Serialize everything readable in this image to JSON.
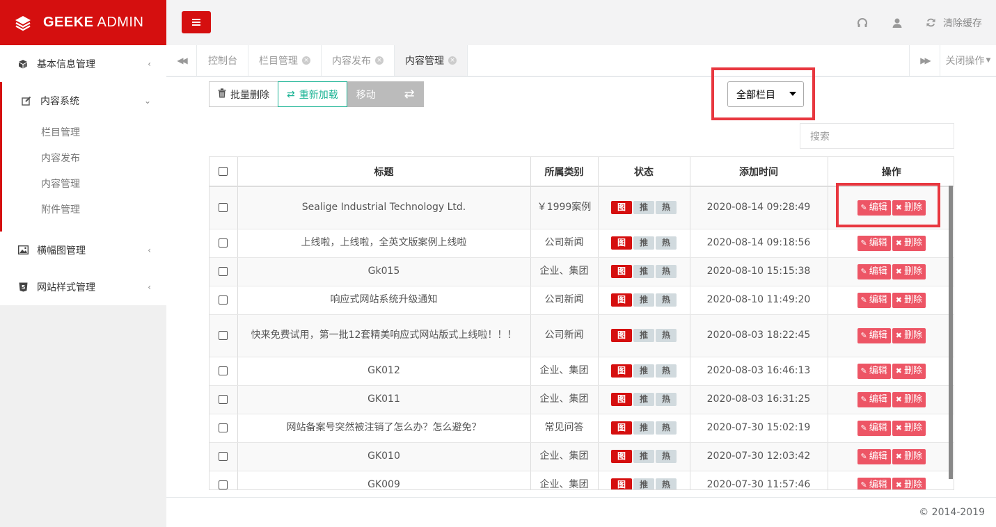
{
  "brand": {
    "name_bold": "GEEKE",
    "name_rest": " ADMIN"
  },
  "header": {
    "clear_cache_label": "清除缓存"
  },
  "sidebar": {
    "items": [
      {
        "label": "基本信息管理",
        "icon": "cube-icon"
      },
      {
        "label": "内容系统",
        "icon": "edit-icon",
        "sub": [
          "栏目管理",
          "内容发布",
          "内容管理",
          "附件管理"
        ]
      },
      {
        "label": "横幅图管理",
        "icon": "image-icon"
      },
      {
        "label": "网站样式管理",
        "icon": "html5-icon"
      }
    ]
  },
  "tabs": [
    {
      "label": "控制台"
    },
    {
      "label": "栏目管理"
    },
    {
      "label": "内容发布"
    },
    {
      "label": "内容管理"
    }
  ],
  "close_ops_label": "关闭操作",
  "toolbar": {
    "batch_delete": "批量删除",
    "reload": "重新加载",
    "move": "移动"
  },
  "category_select": {
    "selected": "全部栏目"
  },
  "search": {
    "placeholder": "搜索"
  },
  "table": {
    "headers": [
      "标题",
      "所属类别",
      "状态",
      "添加时间",
      "操作"
    ],
    "badges": [
      "图",
      "推",
      "热"
    ],
    "edit_label": "编辑",
    "delete_label": "删除",
    "rows": [
      {
        "title": "Sealige Industrial Technology Ltd.",
        "category": "￥1999案例",
        "time": "2020-08-14 09:28:49"
      },
      {
        "title": "上线啦，上线啦，全英文版案例上线啦",
        "category": "公司新闻",
        "time": "2020-08-14 09:18:56"
      },
      {
        "title": "Gk015",
        "category": "企业、集团",
        "time": "2020-08-10 15:15:38"
      },
      {
        "title": "响应式网站系统升级通知",
        "category": "公司新闻",
        "time": "2020-08-10 11:49:20"
      },
      {
        "title": "快来免费试用，第一批12套精美响应式网站版式上线啦！！！",
        "category": "公司新闻",
        "time": "2020-08-03 18:22:45"
      },
      {
        "title": "GK012",
        "category": "企业、集团",
        "time": "2020-08-03 16:46:13"
      },
      {
        "title": "GK011",
        "category": "企业、集团",
        "time": "2020-08-03 16:31:25"
      },
      {
        "title": "网站备案号突然被注销了怎么办？怎么避免？",
        "category": "常见问答",
        "time": "2020-07-30 15:02:19"
      },
      {
        "title": "GK010",
        "category": "企业、集团",
        "time": "2020-07-30 12:03:42"
      },
      {
        "title": "GK009",
        "category": "企业、集团",
        "time": "2020-07-30 11:57:46"
      }
    ]
  },
  "footer": {
    "copyright": "© 2014-2019"
  },
  "colors": {
    "brand": "#d50f0f",
    "accent": "#1ab394",
    "danger": "#ed5565",
    "highlight": "#e8373f"
  }
}
